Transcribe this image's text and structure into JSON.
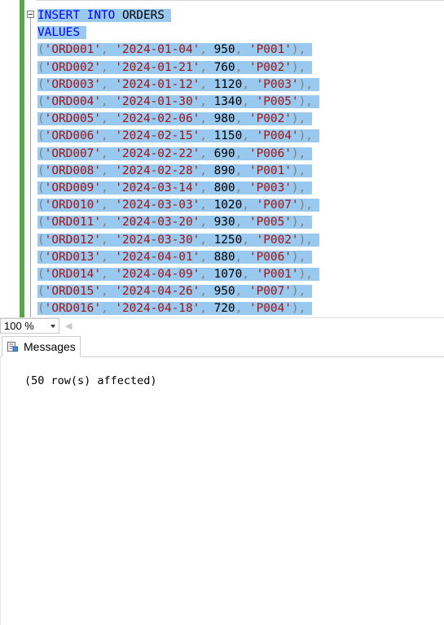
{
  "editor": {
    "lines": [
      {
        "type": "insert",
        "kw1": "INSERT",
        "kw2": "INTO",
        "table": "ORDERS"
      },
      {
        "type": "values",
        "kw": "VALUES"
      },
      {
        "id": "'ORD001'",
        "date": "'2024-01-04'",
        "amount": "950",
        "product": "'P001'"
      },
      {
        "id": "'ORD002'",
        "date": "'2024-01-21'",
        "amount": "760",
        "product": "'P002'"
      },
      {
        "id": "'ORD003'",
        "date": "'2024-01-12'",
        "amount": "1120",
        "product": "'P003'"
      },
      {
        "id": "'ORD004'",
        "date": "'2024-01-30'",
        "amount": "1340",
        "product": "'P005'"
      },
      {
        "id": "'ORD005'",
        "date": "'2024-02-06'",
        "amount": "980",
        "product": "'P002'"
      },
      {
        "id": "'ORD006'",
        "date": "'2024-02-15'",
        "amount": "1150",
        "product": "'P004'"
      },
      {
        "id": "'ORD007'",
        "date": "'2024-02-22'",
        "amount": "690",
        "product": "'P006'"
      },
      {
        "id": "'ORD008'",
        "date": "'2024-02-28'",
        "amount": "890",
        "product": "'P001'"
      },
      {
        "id": "'ORD009'",
        "date": "'2024-03-14'",
        "amount": "800",
        "product": "'P003'"
      },
      {
        "id": "'ORD010'",
        "date": "'2024-03-03'",
        "amount": "1020",
        "product": "'P007'"
      },
      {
        "id": "'ORD011'",
        "date": "'2024-03-20'",
        "amount": "930",
        "product": "'P005'"
      },
      {
        "id": "'ORD012'",
        "date": "'2024-03-30'",
        "amount": "1250",
        "product": "'P002'"
      },
      {
        "id": "'ORD013'",
        "date": "'2024-04-01'",
        "amount": "880",
        "product": "'P006'"
      },
      {
        "id": "'ORD014'",
        "date": "'2024-04-09'",
        "amount": "1070",
        "product": "'P001'"
      },
      {
        "id": "'ORD015'",
        "date": "'2024-04-26'",
        "amount": "950",
        "product": "'P007'"
      },
      {
        "id": "'ORD016'",
        "date": "'2024-04-18'",
        "amount": "720",
        "product": "'P004'"
      }
    ]
  },
  "status": {
    "zoom": "100 %"
  },
  "results": {
    "tab_label": "Messages",
    "message": "(50 row(s) affected)"
  },
  "colors": {
    "keyword": "#0000ff",
    "string": "#a31515",
    "selection": "#99c9ef",
    "change_bar": "#57a64a"
  }
}
